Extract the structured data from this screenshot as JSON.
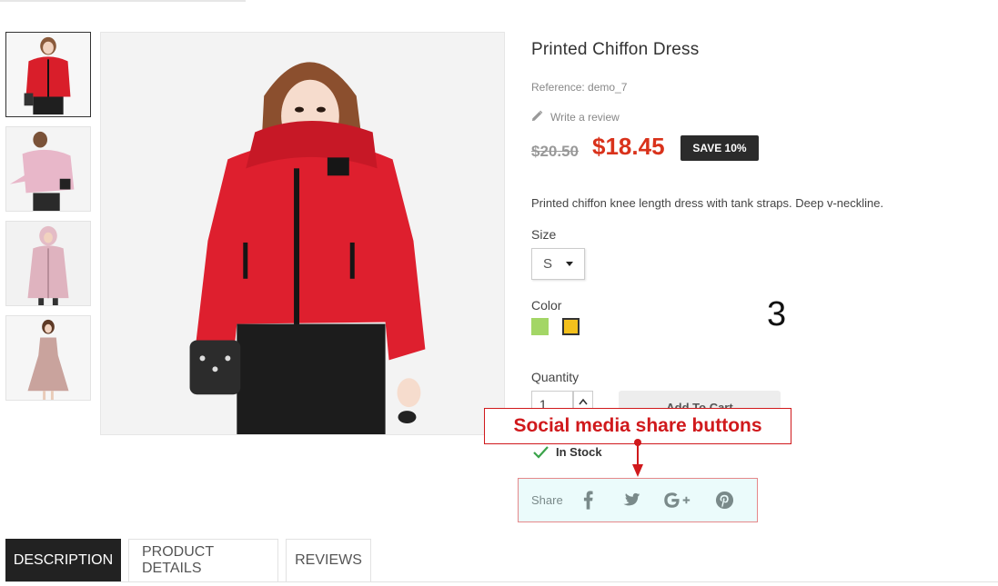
{
  "product": {
    "title": "Printed Chiffon Dress",
    "reference": "Reference: demo_7",
    "write_review": "Write a review",
    "old_price": "$20.50",
    "new_price": "$18.45",
    "save_badge": "SAVE 10%",
    "description": "Printed chiffon knee length dress with tank straps. Deep v-neckline."
  },
  "options": {
    "size_label": "Size",
    "size_value": "S",
    "color_label": "Color",
    "colors": [
      "#a3d666",
      "#f3c01c"
    ],
    "quantity_label": "Quantity",
    "quantity_value": "1",
    "add_to_cart": "Add To Cart"
  },
  "stock": {
    "label": "In Stock"
  },
  "share": {
    "label": "Share",
    "icons": [
      "facebook-icon",
      "twitter-icon",
      "google-plus-icon",
      "pinterest-icon"
    ],
    "icon_color": "#7a8a8a"
  },
  "annotation": {
    "callout": "Social media share buttons",
    "number": "3",
    "color": "#d0191c"
  },
  "tabs": [
    {
      "label": "DESCRIPTION",
      "active": true
    },
    {
      "label": "PRODUCT DETAILS",
      "active": false
    },
    {
      "label": "REVIEWS",
      "active": false
    }
  ],
  "accent": {
    "price": "#d9321b",
    "badge": "#2b2b2b",
    "share_bg": "#ebfbfb"
  }
}
